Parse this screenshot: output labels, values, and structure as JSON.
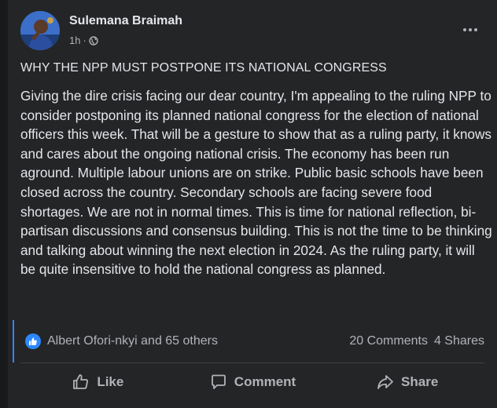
{
  "post": {
    "author": "Sulemana Braimah",
    "time": "1h",
    "privacy_icon": "globe-icon",
    "title": "WHY THE NPP MUST POSTPONE ITS NATIONAL CONGRESS",
    "body": "Giving the dire crisis facing our dear country, I'm appealing to the ruling NPP to consider postponing its planned national congress for the election of national officers this week. That will be a gesture to show that as a ruling party, it knows and cares about the ongoing national crisis. The economy has been run aground. Multiple labour unions are on strike. Public basic schools have been closed across the country. Secondary schools are facing severe food shortages. We are not in normal times. This is time for national reflection, bi-partisan discussions and consensus building. This is not the time to be thinking and talking about winning the next election in 2024. As the ruling party, it will be quite insensitive to hold the national congress as planned."
  },
  "engagement": {
    "reactions_text": "Albert Ofori-nkyi and 65 others",
    "comments": "20 Comments",
    "shares": "4 Shares"
  },
  "actions": {
    "like": "Like",
    "comment": "Comment",
    "share": "Share"
  },
  "colors": {
    "background": "#242526",
    "text": "#e4e6eb",
    "secondary_text": "#b0b3b8",
    "accent": "#2d88ff"
  }
}
